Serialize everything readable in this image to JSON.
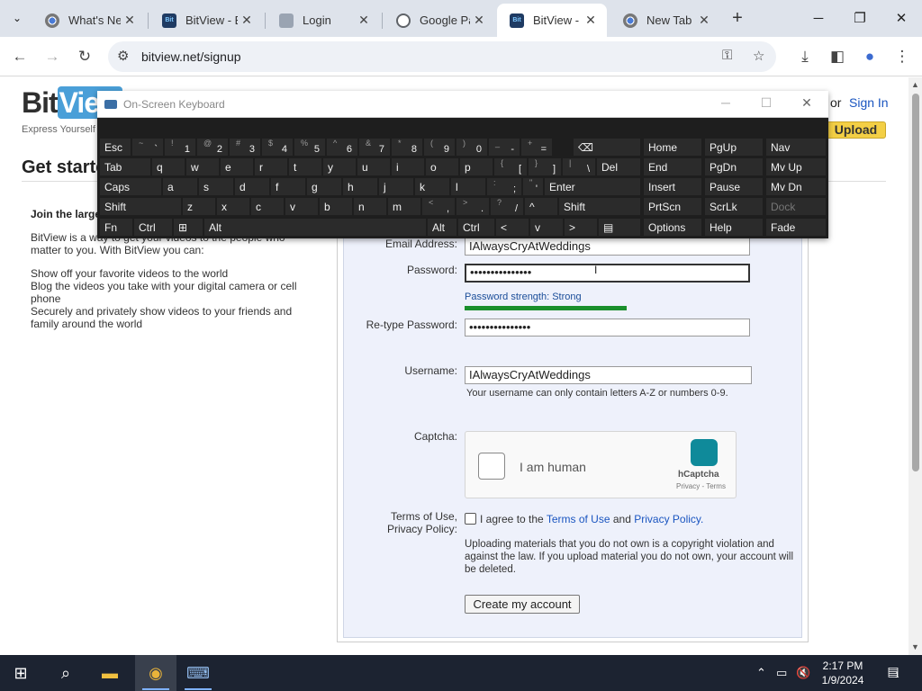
{
  "browser": {
    "tabs": [
      {
        "label": "What's Ne"
      },
      {
        "label": "BitView - B"
      },
      {
        "label": "Login"
      },
      {
        "label": "Google Pa"
      },
      {
        "label": "BitView - B"
      },
      {
        "label": "New Tab"
      }
    ],
    "active_tab": 4,
    "url": "bitview.net/signup",
    "controls": {
      "minimize": "─",
      "restore": "❐",
      "close": "✕",
      "newtab": "+"
    }
  },
  "site": {
    "logo_bit": "Bit",
    "logo_view": "View",
    "tagline": "Express Yourself",
    "or": "or",
    "sign_in": "Sign In",
    "upload": "Upload"
  },
  "left": {
    "heading": "Get started",
    "join": "Join the largest",
    "intro": "BitView is a way to get your videos to the people who matter to you. With BitView you can:",
    "bullets": [
      "Show off your favorite videos to the world",
      "Blog the videos you take with your digital camera or cell phone",
      "Securely and privately show videos to your friends and family around the world"
    ]
  },
  "form": {
    "email_label": "Email Address:",
    "email_value": "IAlwaysCryAtWeddings",
    "password_label": "Password:",
    "password_value": "•••••••••••••••",
    "strength": "Password strength: Strong",
    "strength_level": 1.0,
    "retype_label": "Re-type Password:",
    "retype_value": "•••••••••••••••",
    "username_label": "Username:",
    "username_value": "IAlwaysCryAtWeddings",
    "username_hint": "Your username can only contain letters A-Z or numbers 0-9.",
    "captcha_label": "Captcha:",
    "captcha_text": "I am human",
    "captcha_brand": "hCaptcha",
    "captcha_links": "Privacy - Terms",
    "terms_label_1": "Terms of Use,",
    "terms_label_2": "Privacy Policy:",
    "terms_pre": "I agree to the",
    "terms_link": "Terms of Use",
    "terms_and": "and",
    "privacy_link": "Privacy Policy",
    "terms_end": ".",
    "warning": "Uploading materials that you do not own is a copyright violation and against the law. If you upload material you do not own, your account will be deleted.",
    "create_button": "Create my account"
  },
  "osk": {
    "title": "On-Screen Keyboard",
    "rows": [
      [
        "Esc",
        "~ `",
        "! 1",
        "@ 2",
        "# 3",
        "$ 4",
        "% 5",
        "^ 6",
        "& 7",
        "* 8",
        "( 9",
        ") 0",
        "_ -",
        "+ =",
        "⌫"
      ],
      [
        "Tab",
        "q",
        "w",
        "e",
        "r",
        "t",
        "y",
        "u",
        "i",
        "o",
        "p",
        "{ [",
        "} ]",
        "| \\",
        "Del"
      ],
      [
        "Caps",
        "a",
        "s",
        "d",
        "f",
        "g",
        "h",
        "j",
        "k",
        "l",
        ": ;",
        "\" '",
        "Enter"
      ],
      [
        "Shift",
        "z",
        "x",
        "c",
        "v",
        "b",
        "n",
        "m",
        "< ,",
        "> .",
        "? /",
        "^",
        "Shift"
      ],
      [
        "Fn",
        "Ctrl",
        "⊞",
        "Alt",
        "Alt",
        "Ctrl",
        "<",
        "v",
        ">",
        "▤"
      ]
    ],
    "nav": [
      [
        "Home",
        "PgUp",
        "Nav"
      ],
      [
        "End",
        "PgDn",
        "Mv Up"
      ],
      [
        "Insert",
        "Pause",
        "Mv Dn"
      ],
      [
        "PrtScn",
        "ScrLk",
        "Dock"
      ],
      [
        "Options",
        "Help",
        "Fade"
      ]
    ]
  },
  "taskbar": {
    "time": "2:17 PM",
    "date": "1/9/2024",
    "notif_count": "1"
  }
}
